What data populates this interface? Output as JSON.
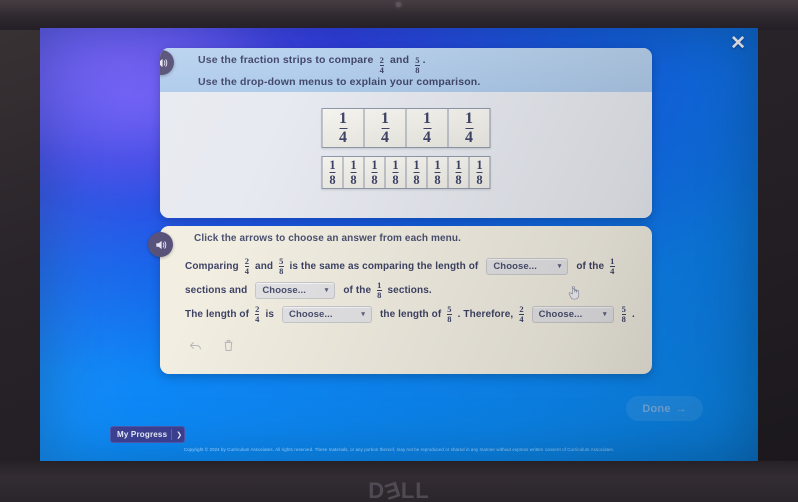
{
  "device": {
    "brand": "DELL"
  },
  "window": {
    "close_icon": "close-icon"
  },
  "card_prompt": {
    "audio_icon": "speaker-icon",
    "line1_a": "Use the fraction strips to compare",
    "line1_frac1": {
      "num": "2",
      "den": "4"
    },
    "line1_b": "and",
    "line1_frac2": {
      "num": "5",
      "den": "8"
    },
    "line1_c": ".",
    "line2": "Use the drop-down menus to explain your comparison."
  },
  "fraction_strips": {
    "strip_fourths": {
      "count": 4,
      "num": "1",
      "den": "4"
    },
    "strip_eighths": {
      "count": 8,
      "num": "1",
      "den": "8"
    }
  },
  "card_answer": {
    "audio_icon": "speaker-icon",
    "hint": "Click the arrows to choose an answer from each menu.",
    "dropdown_placeholder": "Choose...",
    "caret": "▾",
    "line1": {
      "t1": "Comparing",
      "f1": {
        "num": "2",
        "den": "4"
      },
      "t2": "and",
      "f2": {
        "num": "5",
        "den": "8"
      },
      "t3": "is the same as comparing the length of",
      "t4": "of the",
      "f3": {
        "num": "1",
        "den": "4"
      }
    },
    "line2": {
      "t1": "sections and",
      "t2": "of the",
      "f1": {
        "num": "1",
        "den": "8"
      },
      "t3": "sections."
    },
    "line3": {
      "t1": "The length of",
      "f1": {
        "num": "2",
        "den": "4"
      },
      "t2": "is",
      "t3": "the length of",
      "f2": {
        "num": "5",
        "den": "8"
      },
      "t4": ". Therefore,",
      "f3": {
        "num": "2",
        "den": "4"
      },
      "f4": {
        "num": "5",
        "den": "8"
      },
      "t5": "."
    },
    "tools": {
      "undo_icon": "undo-arrow-icon",
      "delete_icon": "trash-icon"
    }
  },
  "done_button": {
    "label": "Done",
    "arrow": "→"
  },
  "footer": {
    "progress_label": "My Progress",
    "progress_caret": "❯",
    "copyright": "Copyright © 2024 by Curriculum Associates. All rights reserved. These materials, or any portion thereof, may not be reproduced or shared in any manner without express written consent of Curriculum Associates."
  },
  "colors": {
    "screen_blue": "#0c90fb",
    "accent_purple": "#554f78",
    "card_prompt_header": "#aecbeb",
    "card_answer_bg": "#f2eee2"
  }
}
